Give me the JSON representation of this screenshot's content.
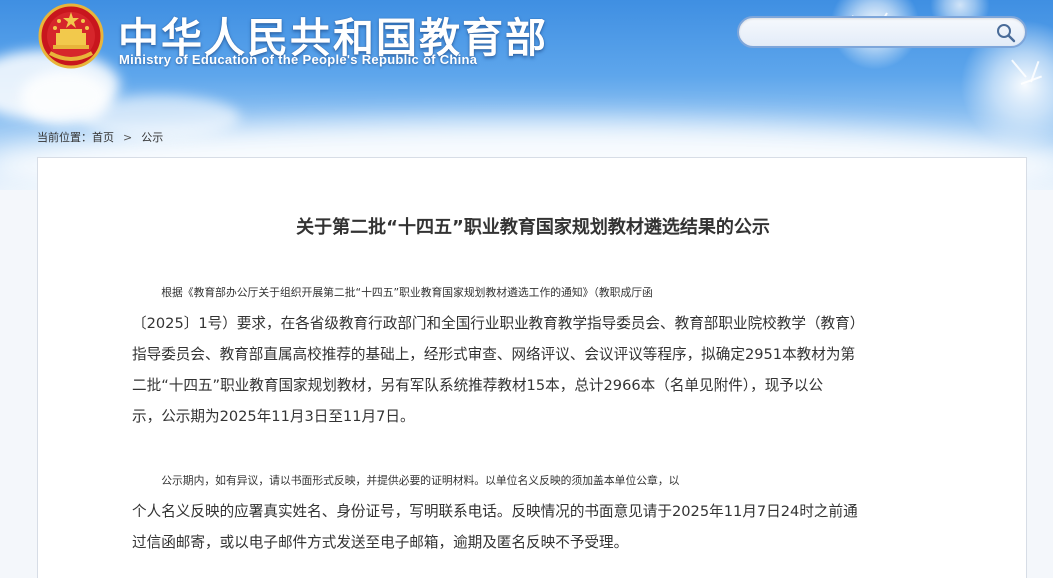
{
  "header": {
    "title": "中华人民共和国教育部",
    "subtitle": "Ministry of Education of the People's Republic of China",
    "emblem_icon": "national-emblem-icon"
  },
  "search": {
    "value": "",
    "placeholder": "",
    "icon": "search-icon"
  },
  "breadcrumb": {
    "prefix": "当前位置：",
    "items": [
      "首页",
      "公示"
    ],
    "separator": ">"
  },
  "article": {
    "title": "关于第二批“十四五”职业教育国家规划教材遴选结果的公示",
    "paragraphs": [
      {
        "lines": [
          "根据《教育部办公厅关于组织开展第二批“十四五”职业教育国家规划教材遴选工作的通知》（教职成厅函",
          "〔2025〕1号）要求，在各省级教育行政部门和全国行业职业教育教学指导委员会、教育部职业院校教学（教育）",
          "指导委员会、教育部直属高校推荐的基础上，经形式审查、网络评议、会议评议等程序，拟确定2951本教材为第",
          "二批“十四五”职业教育国家规划教材，另有军队系统推荐教材15本，总计2966本（名单见附件），现予以公",
          "示，公示期为2025年11月3日至11月7日。"
        ]
      },
      {
        "lines": [
          "公示期内，如有异议，请以书面形式反映，并提供必要的证明材料。以单位名义反映的须加盖本单位公章，以",
          "个人名义反映的应署真实姓名、身份证号，写明联系电话。反映情况的书面意见请于2025年11月7日24时之前通",
          "过信函邮寄，或以电子邮件方式发送至电子邮箱，逾期及匿名反映不予受理。"
        ]
      }
    ]
  },
  "colors": {
    "sky_top": "#3f8fe2",
    "sky_bottom": "#e6f1fc",
    "text": "#333333",
    "card_border": "#d7dde6"
  }
}
